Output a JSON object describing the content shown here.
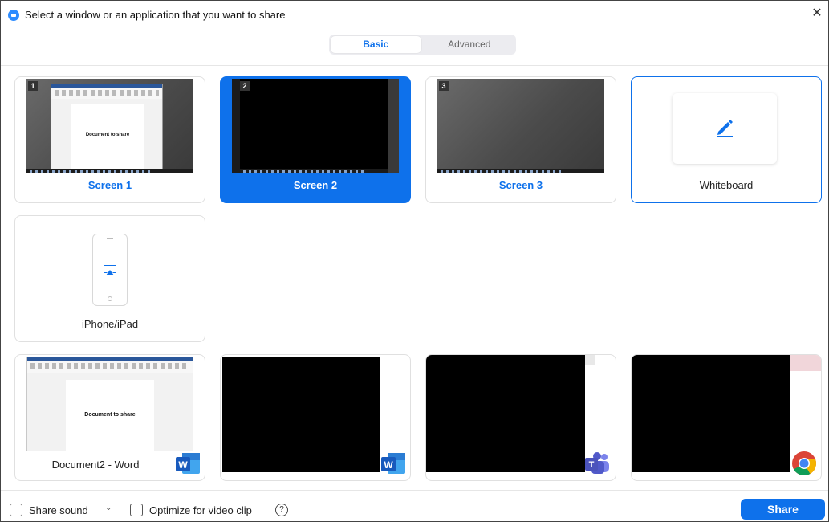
{
  "window": {
    "title": "Select a window or an application that you want to share",
    "close_glyph": "✕"
  },
  "tabs": [
    {
      "label": "Basic",
      "active": true
    },
    {
      "label": "Advanced",
      "active": false
    }
  ],
  "screens": [
    {
      "label": "Screen 1",
      "badge": "1",
      "thumb_text": "Document to share"
    },
    {
      "label": "Screen 2",
      "badge": "2",
      "selected": true
    },
    {
      "label": "Screen 3",
      "badge": "3"
    }
  ],
  "whiteboard": {
    "label": "Whiteboard",
    "icon": "pencil-icon"
  },
  "iphone": {
    "label": "iPhone/iPad",
    "icon": "airplay-icon"
  },
  "apps": [
    {
      "label": "Document2 - Word",
      "thumb_text": "Document to share",
      "icon": "word-icon"
    },
    {
      "label": "",
      "icon": "word-icon"
    },
    {
      "label": "",
      "icon": "teams-icon"
    },
    {
      "label": "",
      "icon": "chrome-icon"
    }
  ],
  "bottom": {
    "share_sound_label": "Share sound",
    "optimize_label": "Optimize for video clip",
    "help_glyph": "?",
    "chevron_glyph": "⌄",
    "share_button_label": "Share"
  },
  "colors": {
    "accent": "#0e71eb",
    "word": "#2b579a",
    "teams": "#5059c9"
  }
}
